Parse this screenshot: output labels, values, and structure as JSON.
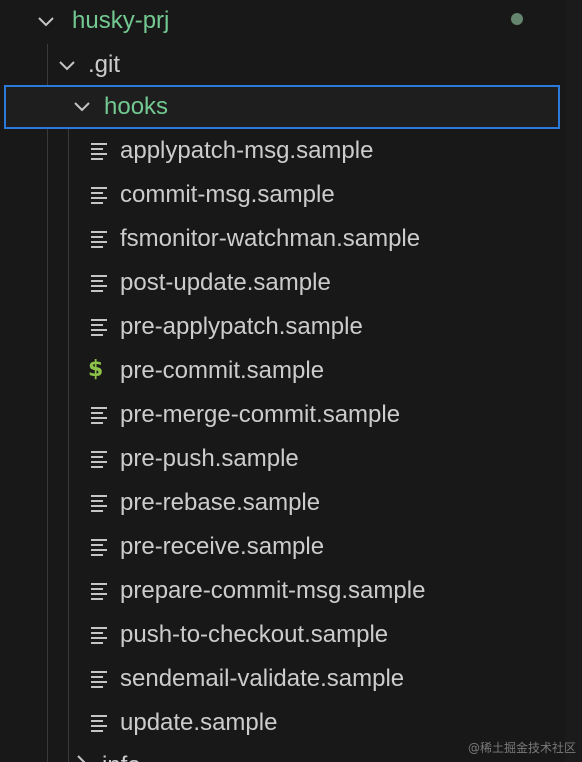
{
  "explorer": {
    "root": {
      "label": "husky-prj",
      "modified_indicator": "dot"
    },
    "git": {
      "label": ".git"
    },
    "hooks": {
      "label": "hooks"
    },
    "files": [
      {
        "label": "applypatch-msg.sample",
        "icon": "lines-icon"
      },
      {
        "label": "commit-msg.sample",
        "icon": "lines-icon"
      },
      {
        "label": "fsmonitor-watchman.sample",
        "icon": "lines-icon"
      },
      {
        "label": "post-update.sample",
        "icon": "lines-icon"
      },
      {
        "label": "pre-applypatch.sample",
        "icon": "lines-icon"
      },
      {
        "label": "pre-commit.sample",
        "icon": "dollar-icon"
      },
      {
        "label": "pre-merge-commit.sample",
        "icon": "lines-icon"
      },
      {
        "label": "pre-push.sample",
        "icon": "lines-icon"
      },
      {
        "label": "pre-rebase.sample",
        "icon": "lines-icon"
      },
      {
        "label": "pre-receive.sample",
        "icon": "lines-icon"
      },
      {
        "label": "prepare-commit-msg.sample",
        "icon": "lines-icon"
      },
      {
        "label": "push-to-checkout.sample",
        "icon": "lines-icon"
      },
      {
        "label": "sendemail-validate.sample",
        "icon": "lines-icon"
      },
      {
        "label": "update.sample",
        "icon": "lines-icon"
      }
    ],
    "next_folder": {
      "label": "info"
    }
  },
  "colors": {
    "background": "#181818",
    "folder_text": "#73c991",
    "file_text": "#cccccc",
    "selection_border": "#2b79d8",
    "dollar_icon": "#8dc149",
    "modified_dot": "#66856e"
  },
  "watermark": "@稀土掘金技术社区"
}
